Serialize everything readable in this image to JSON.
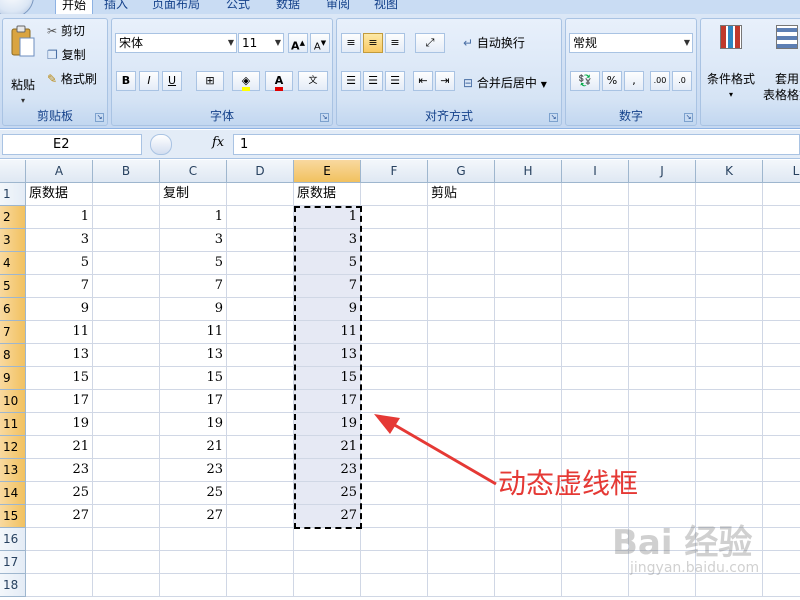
{
  "ribbon": {
    "tabs": [
      "开始",
      "插入",
      "页面布局",
      "公式",
      "数据",
      "审阅",
      "视图"
    ],
    "clipboard": {
      "paste": "粘贴",
      "cut": "剪切",
      "copy": "复制",
      "format_painter": "格式刷",
      "label": "剪贴板"
    },
    "font": {
      "name": "宋体",
      "size": "11",
      "bold": "B",
      "italic": "I",
      "underline": "U",
      "label": "字体"
    },
    "alignment": {
      "wrap": "自动换行",
      "merge": "合并后居中",
      "label": "对齐方式"
    },
    "number": {
      "format": "常规",
      "percent": "%",
      "comma": ",",
      "label": "数字"
    },
    "styles": {
      "conditional": "条件格式",
      "table_line1": "套用",
      "table_line2": "表格格式"
    }
  },
  "formula_bar": {
    "name_box": "E2",
    "fx": "fx",
    "value": "1"
  },
  "sheet": {
    "columns": [
      "A",
      "B",
      "C",
      "D",
      "E",
      "F",
      "G",
      "H",
      "I",
      "J",
      "K",
      "L"
    ],
    "rows": [
      "1",
      "2",
      "3",
      "4",
      "5",
      "6",
      "7",
      "8",
      "9",
      "10",
      "11",
      "12",
      "13",
      "14",
      "15",
      "16",
      "17",
      "18"
    ],
    "headers": {
      "A1": "原数据",
      "C1": "复制",
      "E1": "原数据",
      "G1": "剪贴"
    },
    "col_A": [
      "1",
      "3",
      "5",
      "7",
      "9",
      "11",
      "13",
      "15",
      "17",
      "19",
      "21",
      "23",
      "25",
      "27"
    ],
    "col_C": [
      "1",
      "3",
      "5",
      "7",
      "9",
      "11",
      "13",
      "15",
      "17",
      "19",
      "21",
      "23",
      "25",
      "27"
    ],
    "col_E": [
      "1",
      "3",
      "5",
      "7",
      "9",
      "11",
      "13",
      "15",
      "17",
      "19",
      "21",
      "23",
      "25",
      "27"
    ]
  },
  "annotation": {
    "text": "动态虚线框",
    "color": "#e53935"
  },
  "watermark": {
    "main": "Bai 经验",
    "sub": "jingyan.baidu.com"
  }
}
